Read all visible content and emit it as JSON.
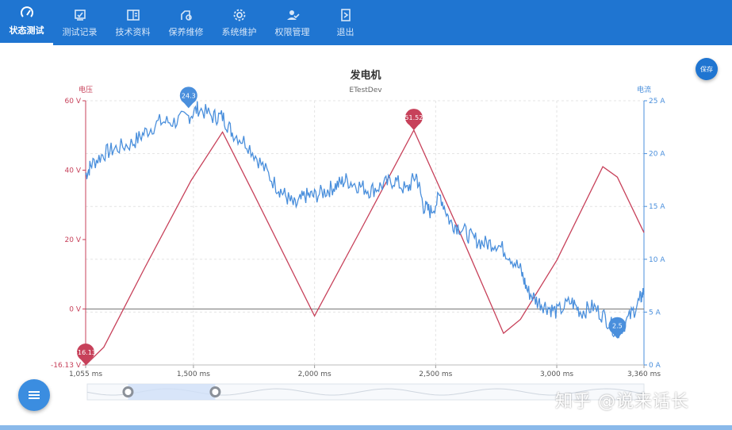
{
  "nav": {
    "items": [
      {
        "label": "状态测试",
        "icon": "gauge-icon",
        "active": true
      },
      {
        "label": "测试记录",
        "icon": "record-icon"
      },
      {
        "label": "技术资料",
        "icon": "docs-icon"
      },
      {
        "label": "保养维修",
        "icon": "maintenance-icon"
      },
      {
        "label": "系统维护",
        "icon": "gear-icon"
      },
      {
        "label": "权限管理",
        "icon": "user-permission-icon"
      },
      {
        "label": "退出",
        "icon": "exit-icon"
      }
    ]
  },
  "save_button": "保存",
  "watermark": "知乎 @说来话长",
  "colors": {
    "header": "#1f75d1",
    "voltage": "#c7415a",
    "current": "#4a8fdc"
  },
  "chart_data": {
    "type": "line",
    "title": "发电机",
    "subtitle": "ETestDev",
    "xlim": [
      1055,
      3360
    ],
    "x_ticks": [
      "1,055 ms",
      "1,500 ms",
      "2,000 ms",
      "2,500 ms",
      "3,000 ms",
      "3,360 ms"
    ],
    "y_left": {
      "label": "电压",
      "range": [
        -16.13,
        60
      ],
      "ticks": [
        "60 V",
        "40 V",
        "20 V",
        "0 V",
        "-16.13 V"
      ]
    },
    "y_right": {
      "label": "电流",
      "range": [
        0,
        25
      ],
      "ticks": [
        "25 A",
        "20 A",
        "15 A",
        "10 A",
        "5 A",
        "0 A"
      ]
    },
    "series": [
      {
        "name": "电压",
        "axis": "left",
        "x": [
          1055,
          1130,
          1300,
          1490,
          1620,
          1750,
          2000,
          2200,
          2410,
          2600,
          2780,
          2850,
          3000,
          3190,
          3250,
          3360
        ],
        "y": [
          -16.13,
          -11,
          12,
          37,
          51,
          33,
          -2,
          24,
          51.52,
          22,
          -7,
          -3,
          14,
          41,
          38,
          22
        ]
      },
      {
        "name": "电流",
        "axis": "right",
        "x": [
          1055,
          1080,
          1130,
          1180,
          1250,
          1300,
          1360,
          1420,
          1480,
          1520,
          1580,
          1620,
          1660,
          1720,
          1780,
          1840,
          1880,
          1920,
          1960,
          2000,
          2050,
          2090,
          2130,
          2180,
          2230,
          2280,
          2330,
          2380,
          2420,
          2450,
          2480,
          2520,
          2560,
          2600,
          2650,
          2700,
          2750,
          2800,
          2850,
          2880,
          2920,
          2960,
          3000,
          3060,
          3100,
          3150,
          3200,
          3250,
          3300,
          3340,
          3360
        ],
        "y": [
          18,
          19,
          20,
          20.5,
          21,
          22,
          23,
          23,
          23.5,
          24.3,
          23.5,
          23.5,
          22,
          21,
          19,
          17,
          16,
          15,
          16,
          16,
          16.5,
          17,
          17.5,
          17,
          16.5,
          17,
          17.5,
          16.5,
          18,
          15,
          14.5,
          16,
          13.5,
          13,
          12,
          11.5,
          11.5,
          10.5,
          9,
          7,
          6,
          5.5,
          5,
          6,
          5,
          5.5,
          4.5,
          3,
          4.5,
          6,
          7
        ]
      }
    ],
    "markers": [
      {
        "series": "电压",
        "type": "max",
        "x": 2410,
        "value": 51.52,
        "label": "51.52"
      },
      {
        "series": "电压",
        "type": "min",
        "x": 1055,
        "value": -16.13,
        "label": "-16.13"
      },
      {
        "series": "电流",
        "type": "max",
        "x": 1480,
        "value": 24.3,
        "label": "24.3"
      },
      {
        "series": "电流",
        "type": "min",
        "x": 3250,
        "value": 2.5,
        "label": "2.5"
      }
    ],
    "grid": true,
    "datazoom": {
      "start_ms": 1230,
      "end_ms": 1590
    }
  }
}
